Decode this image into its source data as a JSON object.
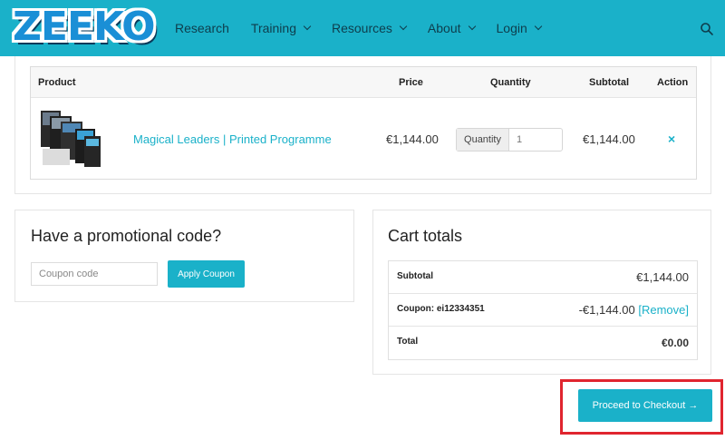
{
  "header": {
    "logo": "ZEEKO",
    "nav": [
      {
        "label": "Research",
        "dropdown": false
      },
      {
        "label": "Training",
        "dropdown": true
      },
      {
        "label": "Resources",
        "dropdown": true
      },
      {
        "label": "About",
        "dropdown": true
      },
      {
        "label": "Login",
        "dropdown": true
      }
    ],
    "search_icon": "search-icon"
  },
  "cart": {
    "columns": {
      "product": "Product",
      "price": "Price",
      "quantity": "Quantity",
      "subtotal": "Subtotal",
      "action": "Action"
    },
    "items": [
      {
        "name": "Magical Leaders | Printed Programme",
        "price": "€1,144.00",
        "quantity_label": "Quantity",
        "quantity": "1",
        "subtotal": "€1,144.00",
        "remove_icon": "×"
      }
    ]
  },
  "promo": {
    "title": "Have a promotional code?",
    "coupon_placeholder": "Coupon code",
    "apply_label": "Apply Coupon"
  },
  "totals": {
    "title": "Cart totals",
    "subtotal_label": "Subtotal",
    "subtotal_value": "€1,144.00",
    "coupon_label": "Coupon: ei12334351",
    "coupon_value": "-€1,144.00",
    "coupon_remove": "[Remove]",
    "total_label": "Total",
    "total_value": "€0.00"
  },
  "checkout": {
    "label": "Proceed to Checkout →"
  },
  "colors": {
    "accent": "#1ab1c9",
    "highlight": "#e0252f",
    "nav_text": "#0e3d4c"
  }
}
